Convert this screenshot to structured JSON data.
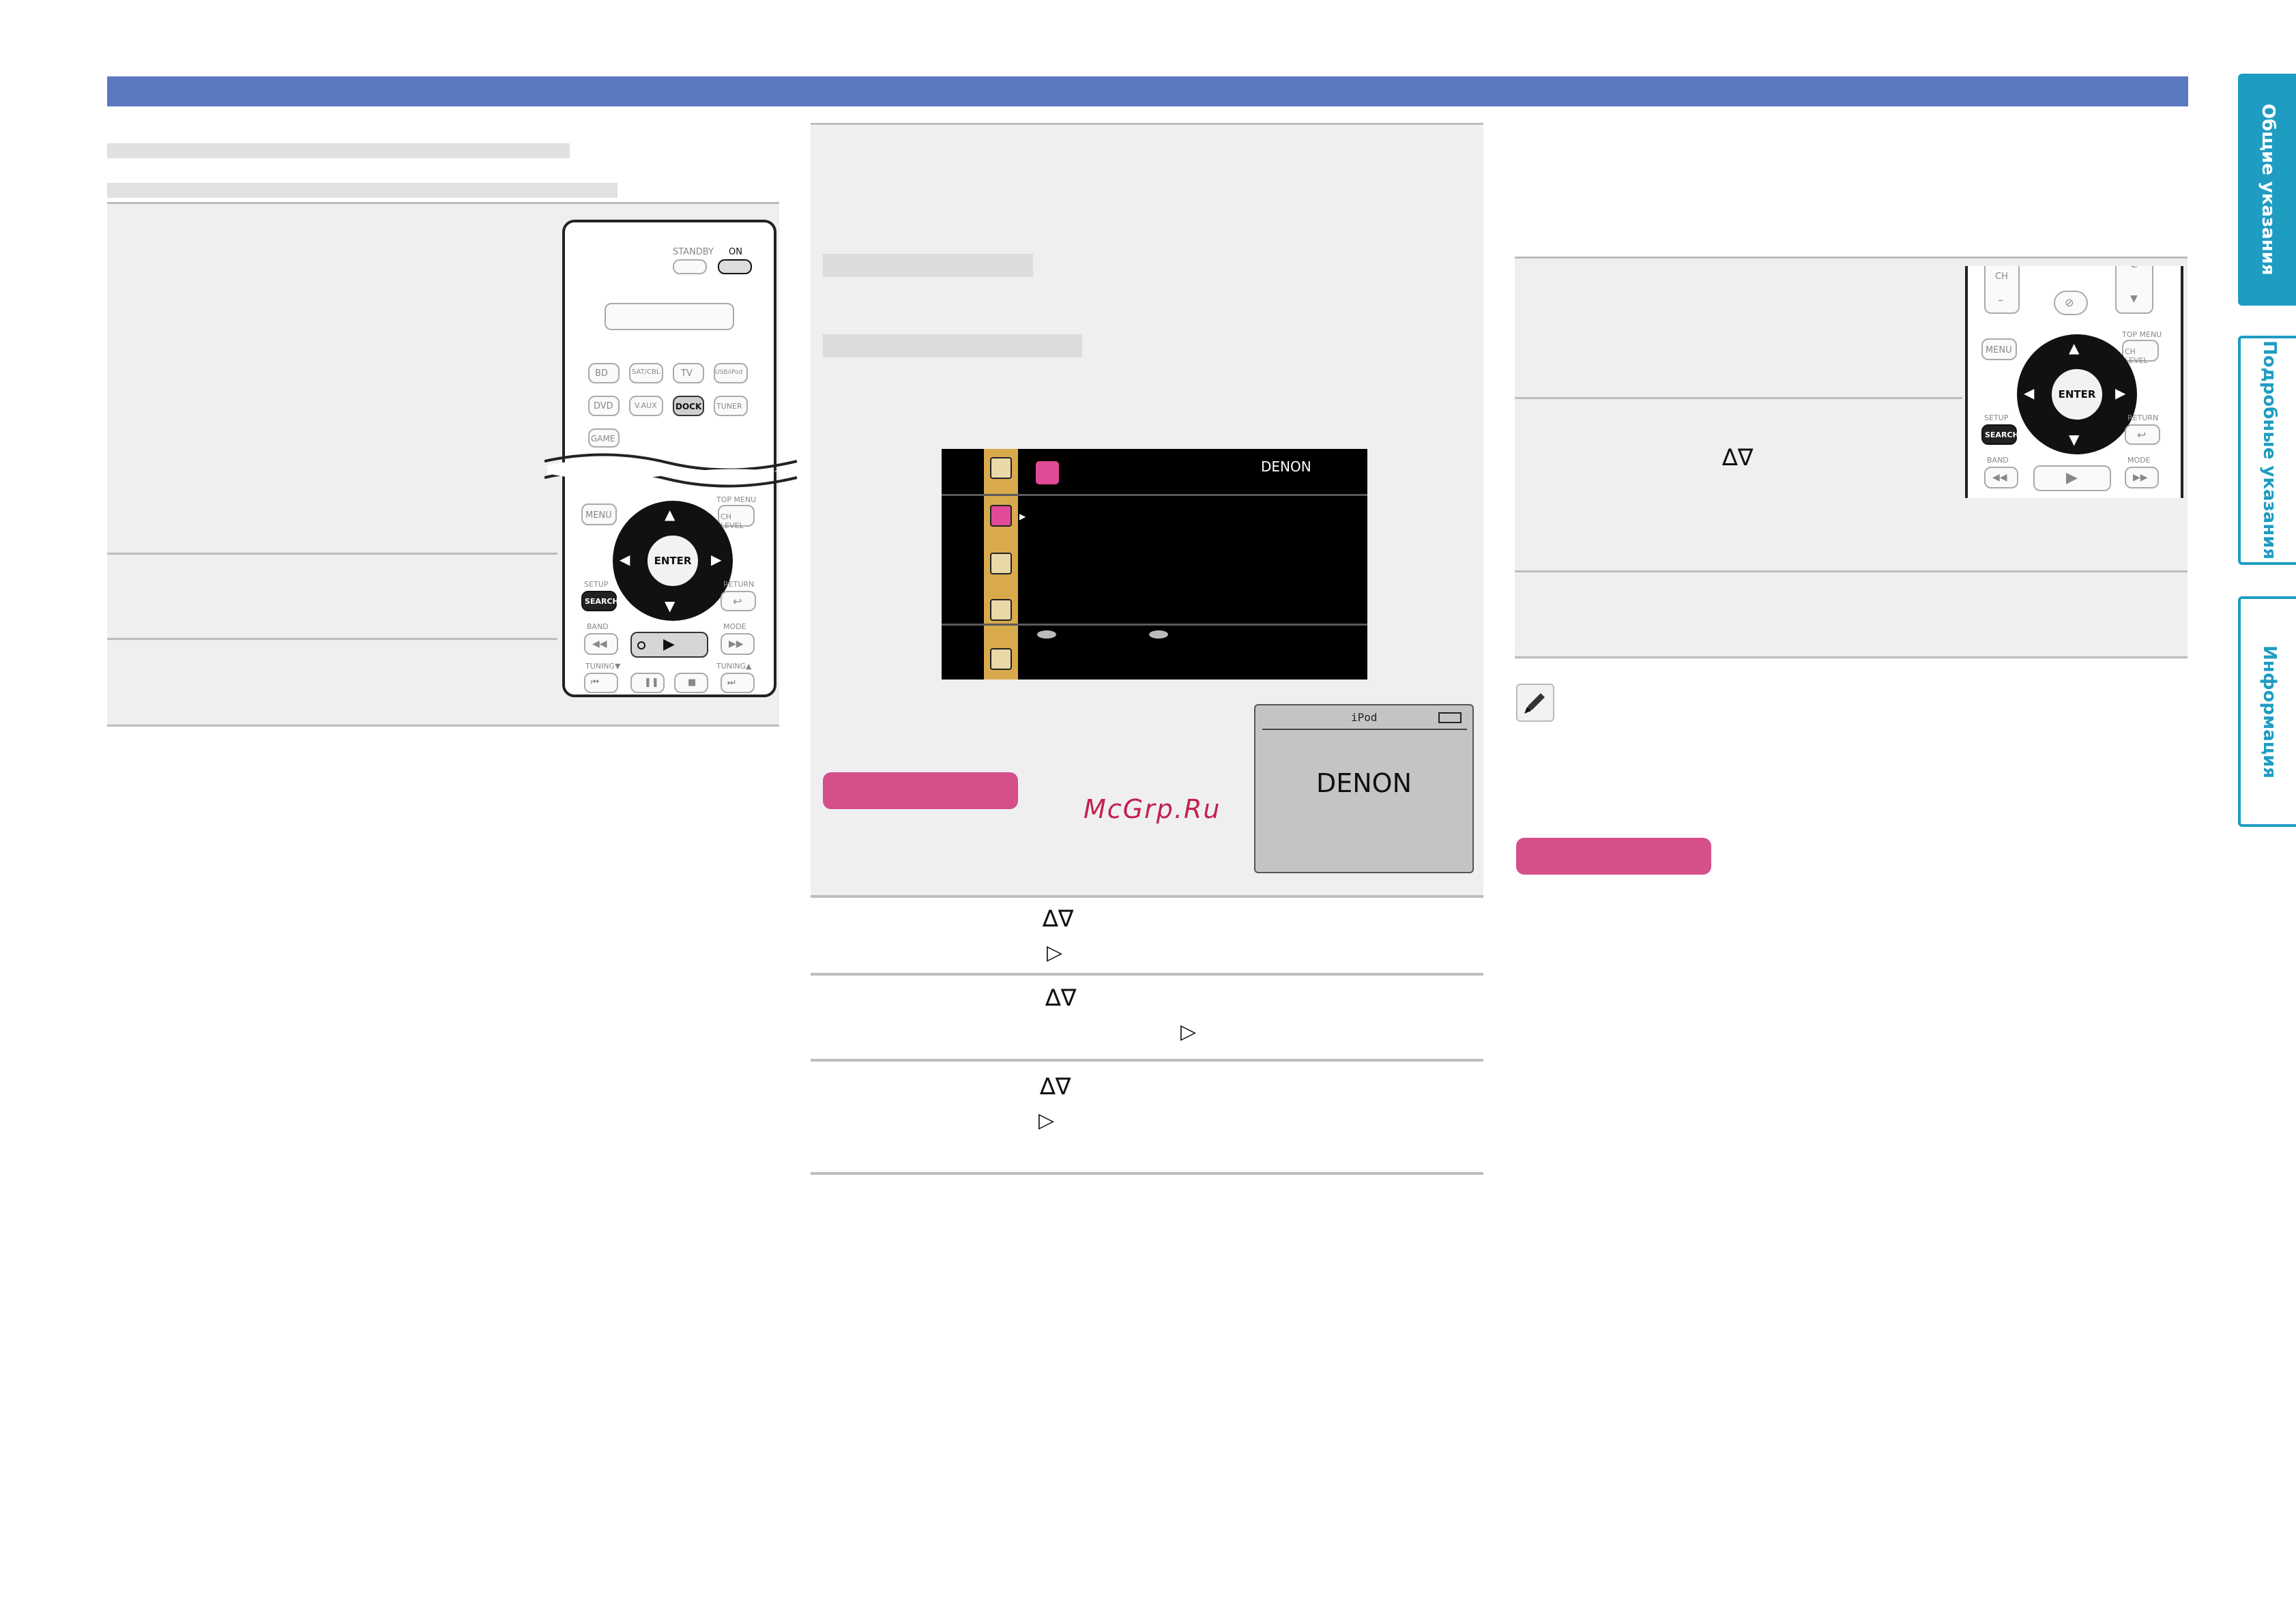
{
  "side_tabs": {
    "general": "Общие указания",
    "detailed": "Подробные указания",
    "info": "Информация"
  },
  "osd": {
    "brand": "DENON"
  },
  "lcd": {
    "source": "iPod",
    "brand": "DENON"
  },
  "watermark": "McGrp.Ru",
  "remote_left": {
    "standby": "STANDBY",
    "on": "ON",
    "sources": [
      "BD",
      "SAT/CBL",
      "TV",
      "USB/iPod",
      "DVD",
      "V.AUX",
      "DOCK",
      "TUNER",
      "GAME"
    ],
    "menu": "MENU",
    "top_menu": "TOP MENU",
    "ch_level": "CH LEVEL",
    "enter": "ENTER",
    "setup": "SETUP",
    "search": "SEARCH",
    "return": "RETURN",
    "band": "BAND",
    "mode": "MODE",
    "tuning_down": "TUNING▼",
    "tuning_up": "TUNING▲"
  },
  "remote_right": {
    "ch": "CH",
    "menu": "MENU",
    "top_menu": "TOP MENU",
    "ch_level": "CH LEVEL",
    "enter": "ENTER",
    "setup": "SETUP",
    "search": "SEARCH",
    "return": "RETURN",
    "band": "BAND",
    "mode": "MODE"
  },
  "steps_middle": [
    {
      "updown": "∆∇",
      "right": "▷"
    },
    {
      "updown": "∆∇",
      "right": "▷"
    },
    {
      "updown": "∆∇",
      "right": "▷"
    }
  ],
  "step_right": {
    "updown": "∆∇"
  }
}
